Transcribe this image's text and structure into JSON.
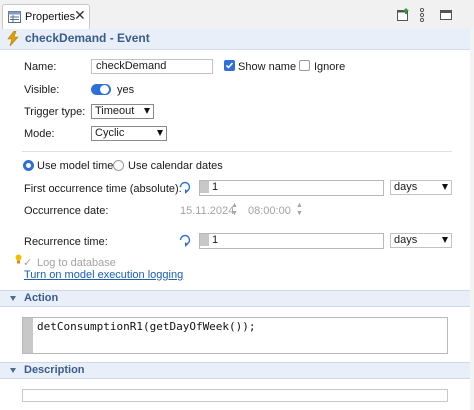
{
  "tab": {
    "label": "Properties",
    "icon": "properties-panel-icon",
    "close": "✕"
  },
  "toolbar": {
    "icons": [
      "new-view-icon",
      "more-vertical-icon",
      "minimize-icon"
    ]
  },
  "header": {
    "title": "checkDemand - Event",
    "icon": "lightning-bolt-icon"
  },
  "form": {
    "name_label": "Name:",
    "name_value": "checkDemand",
    "show_name_label": "Show name",
    "show_name_checked": true,
    "ignore_label": "Ignore",
    "ignore_checked": false,
    "visible_label": "Visible:",
    "visible_value": "yes",
    "trigger_label": "Trigger type:",
    "trigger_value": "Timeout",
    "mode_label": "Mode:",
    "mode_value": "Cyclic",
    "time_mode_options": [
      "Use model time",
      "Use calendar dates"
    ],
    "time_mode_selected": "Use model time",
    "first_occ_label": "First occurrence time (absolute):",
    "first_occ_value": "1",
    "first_occ_unit": "days",
    "occ_date_label": "Occurrence date:",
    "occ_date_value": "15.11.2024",
    "occ_time_value": "08:00:00",
    "recurrence_label": "Recurrence time:",
    "recurrence_value": "1",
    "recurrence_unit": "days",
    "log_db_label": "Log to database",
    "logging_link": "Turn on model execution logging"
  },
  "action": {
    "title": "Action",
    "code": "detConsumptionR1(getDayOfWeek());"
  },
  "description": {
    "title": "Description",
    "text": ""
  },
  "colors": {
    "accent": "#3a5c8c",
    "header_bg": "#e8eff8",
    "link": "#1a5fb4",
    "check": "#2f6fd8"
  }
}
